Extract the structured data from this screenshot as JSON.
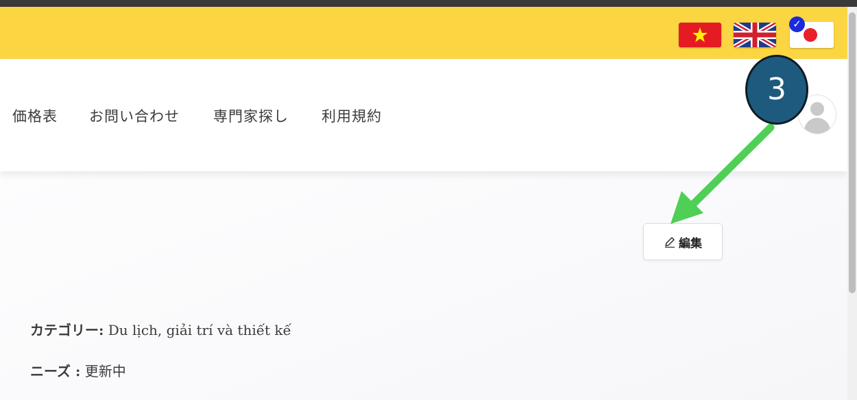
{
  "language_bar": {
    "flags": [
      {
        "name": "vietnamese",
        "color": "#e41b22"
      },
      {
        "name": "english",
        "color": "#1f3b8a"
      },
      {
        "name": "japanese",
        "color": "#e8212c",
        "selected": true
      }
    ],
    "selected_check": "✓"
  },
  "nav": {
    "items": [
      "価格表",
      "お問い合わせ",
      "専門家探し",
      "利用規約"
    ]
  },
  "annotation": {
    "step_number": "3",
    "arrow_color": "#4fcf55"
  },
  "edit_button": {
    "label": "編集",
    "icon": "pencil-icon"
  },
  "details": {
    "category_label": "カテゴリー:",
    "category_value": "Du lịch, giải trí và thiết kế",
    "needs_label": "ニーズ :",
    "needs_value": "更新中"
  },
  "colors": {
    "lang_bar_bg": "#fbd642",
    "step_badge_bg": "#1d5a7e"
  }
}
